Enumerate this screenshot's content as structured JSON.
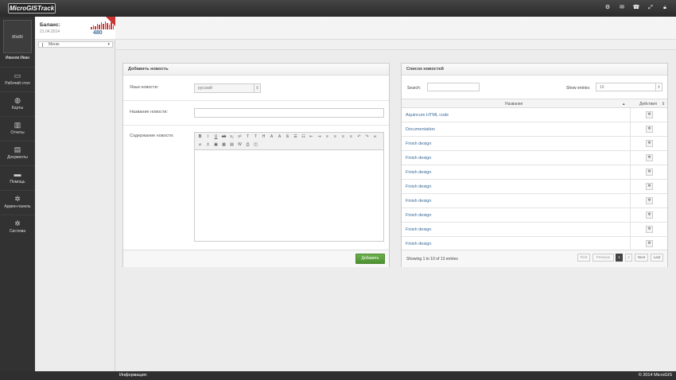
{
  "app": {
    "logo": "MicroGISTrack"
  },
  "topbar": {
    "icons": [
      "settings-icon",
      "message-icon",
      "phone-icon",
      "fullscreen-icon",
      "lock-icon"
    ]
  },
  "user": {
    "avatar_text": "80x80",
    "name": "Иванов Иван"
  },
  "balance": {
    "label": "Баланс:",
    "date": "21.04.2014",
    "amount": "480"
  },
  "menu_select": {
    "value": "Меню"
  },
  "nav": [
    {
      "label": "Рабочий стол",
      "icon": "desktop-icon"
    },
    {
      "label": "Карты",
      "icon": "globe-icon"
    },
    {
      "label": "Отчеты",
      "icon": "chart-icon"
    },
    {
      "label": "Документы",
      "icon": "document-icon"
    },
    {
      "label": "Помощь",
      "icon": "chat-icon"
    },
    {
      "label": "Админ-панель",
      "icon": "gear-icon"
    },
    {
      "label": "Система",
      "icon": "gear-icon"
    }
  ],
  "add_news": {
    "title": "Добавить новость",
    "lang_label": "Язык новости:",
    "lang_value": "русский",
    "name_label": "Название новости:",
    "content_label": "Содержание новости:",
    "submit": "Добавить"
  },
  "news_list": {
    "title": "Список новостей",
    "search_label": "Search:",
    "show_label": "Show entries:",
    "show_value": "10",
    "col_name": "Название",
    "col_action": "Действия",
    "rows": [
      "Aquincum HTML code",
      "Documentation",
      "Finish design",
      "Finish design",
      "Finish design",
      "Finish design",
      "Finish design",
      "Finish design",
      "Finish design",
      "Finish design"
    ],
    "info": "Showing 1 to 10 of 13 entries",
    "pagination": [
      "First",
      "Previous",
      "1",
      "2",
      "Next",
      "Last"
    ]
  },
  "footer": {
    "info": "Информация:",
    "copyright": "© 2014 MicroGIS"
  }
}
